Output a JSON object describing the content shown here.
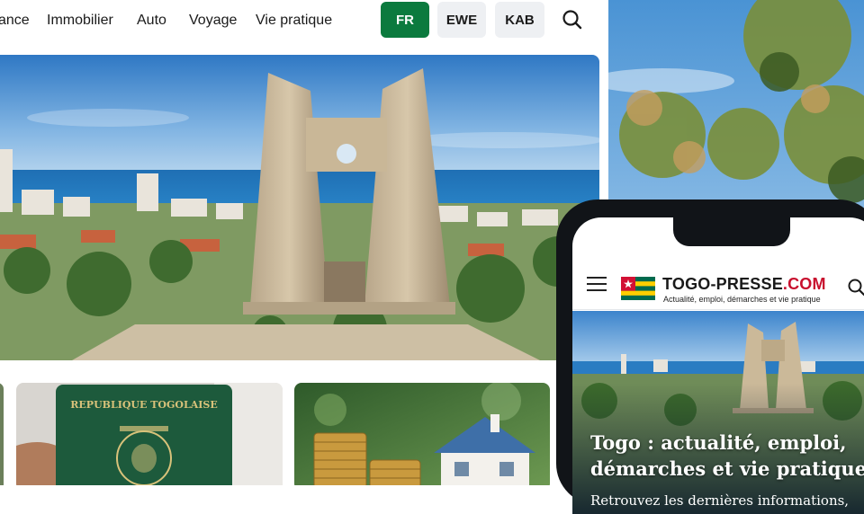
{
  "nav": {
    "items": [
      {
        "label": "ance"
      },
      {
        "label": "Immobilier"
      },
      {
        "label": "Auto"
      },
      {
        "label": "Voyage"
      },
      {
        "label": "Vie pratique"
      }
    ],
    "languages": [
      {
        "label": "FR",
        "active": true
      },
      {
        "label": "EWE",
        "active": false
      },
      {
        "label": "KAB",
        "active": false
      }
    ],
    "search_icon": "search-icon"
  },
  "hero": {
    "image": "independence-monument-lome-photo"
  },
  "cards": [
    {
      "image": "togolese-passport-photo",
      "passport_text": "REPUBLIQUE TOGOLAISE"
    },
    {
      "image": "coins-and-house-photo"
    }
  ],
  "mobile": {
    "menu_icon": "hamburger-menu-icon",
    "flag": "togo-flag",
    "logo_text": "TOGO-PRESSE",
    "logo_suffix": ".COM",
    "tagline": "Actualité, emploi, démarches et vie pratique",
    "search_icon": "search-icon",
    "hero_title": "Togo : actualité, emploi, démarches et vie pratique",
    "hero_subtitle": "Retrouvez les dernières informations,"
  },
  "colors": {
    "accent_green": "#0b7a3e",
    "logo_red": "#c8102e",
    "flag_green": "#006a4e",
    "flag_yellow": "#ffce00",
    "flag_red": "#d21034"
  }
}
